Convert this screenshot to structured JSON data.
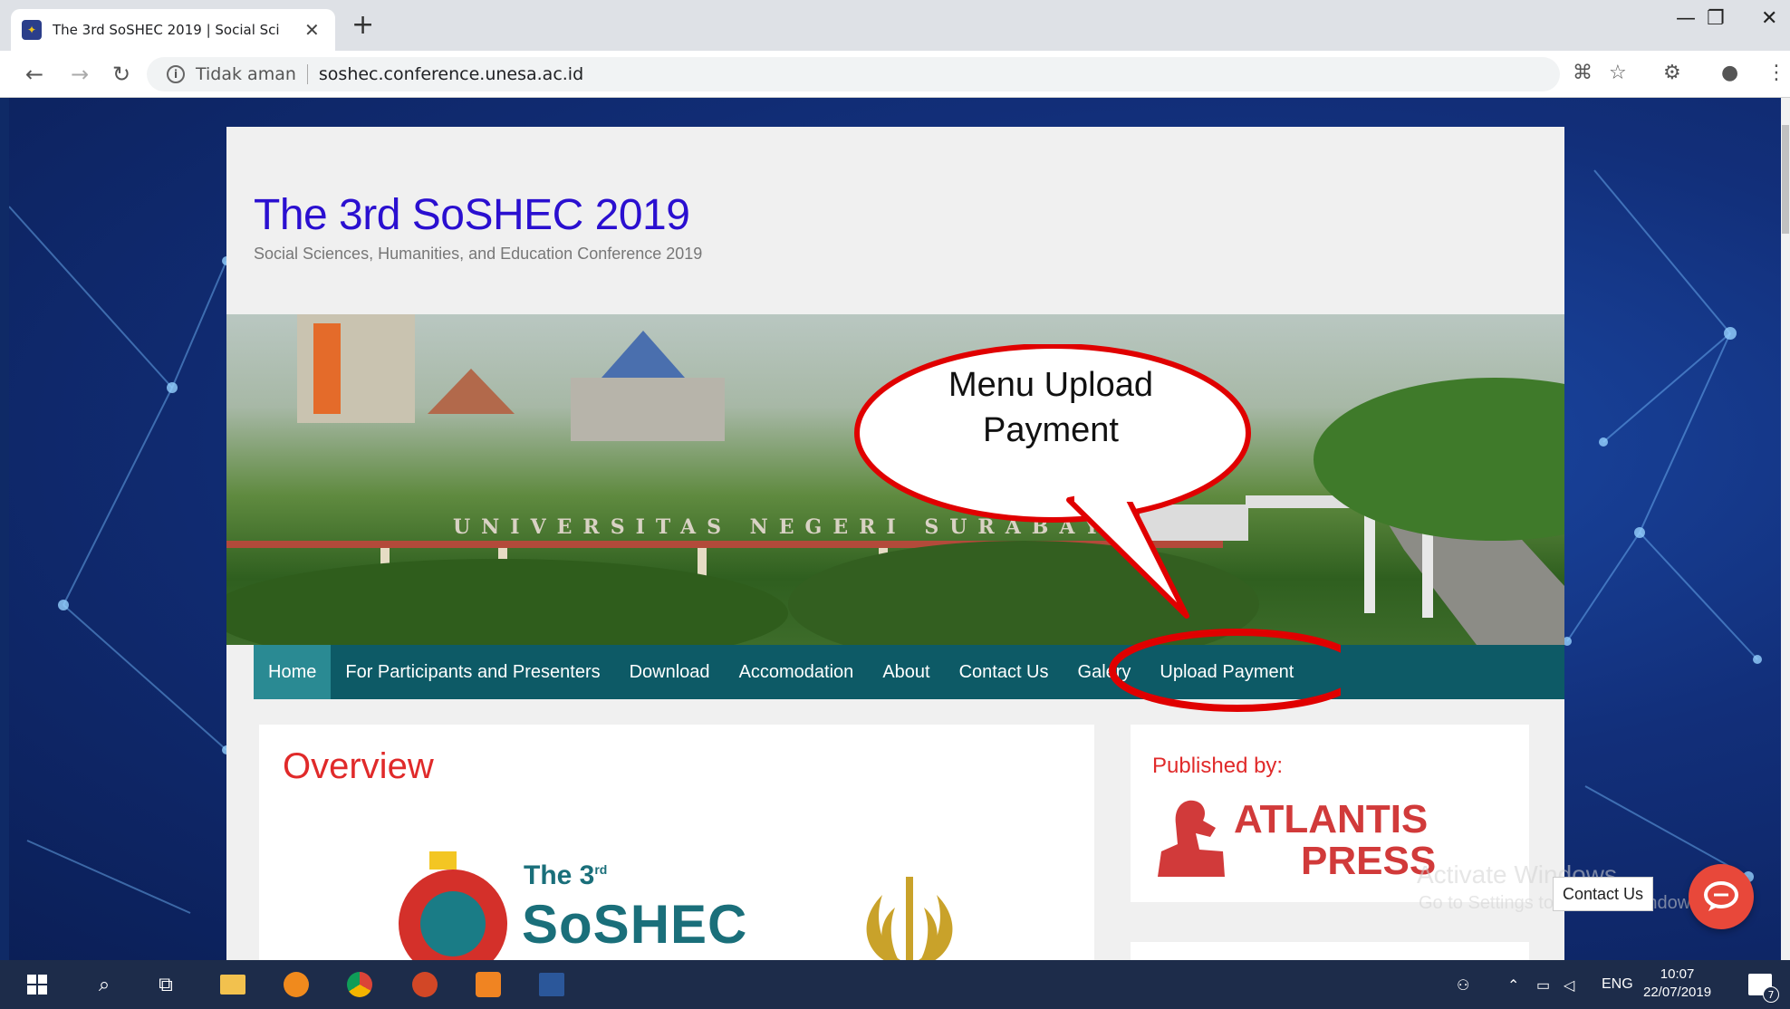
{
  "browser": {
    "tab_title": "The 3rd SoSHEC 2019 | Social Sci",
    "new_tab": "+",
    "security_label": "Tidak aman",
    "url": "soshec.conference.unesa.ac.id"
  },
  "site": {
    "title": "The 3rd SoSHEC 2019",
    "subtitle": "Social Sciences, Humanities, and Education Conference 2019",
    "banner_sign": "UNIVERSITAS NEGERI SURABAYA"
  },
  "menu": {
    "items": [
      {
        "label": "Home",
        "active": true
      },
      {
        "label": "For Participants and Presenters",
        "active": false
      },
      {
        "label": "Download",
        "active": false
      },
      {
        "label": "Accomodation",
        "active": false
      },
      {
        "label": "About",
        "active": false
      },
      {
        "label": "Contact Us",
        "active": false
      },
      {
        "label": "Galery",
        "active": false
      },
      {
        "label": "Upload Payment",
        "active": false
      }
    ]
  },
  "overview": {
    "heading": "Overview",
    "logo_the": "The 3",
    "logo_sup": "rd",
    "logo_name": "SoSHEC"
  },
  "sidebar": {
    "published_label": "Published by:",
    "publisher_line1": "ATLANTIS",
    "publisher_line2": "PRESS"
  },
  "annotation": {
    "line1": "Menu Upload",
    "line2": "Payment",
    "color": "#e00000"
  },
  "watermark": {
    "line1": "Activate Windows",
    "line2": "Go to Settings to activate Windows."
  },
  "chat": {
    "label": "Contact Us"
  },
  "taskbar": {
    "language": "ENG",
    "time": "10:07",
    "date": "22/07/2019",
    "notification_count": "7"
  },
  "colors": {
    "title": "#2a0fd0",
    "menu_bg": "#0d5a66",
    "menu_active": "#2a8a93",
    "accent_red": "#e02a2a"
  }
}
